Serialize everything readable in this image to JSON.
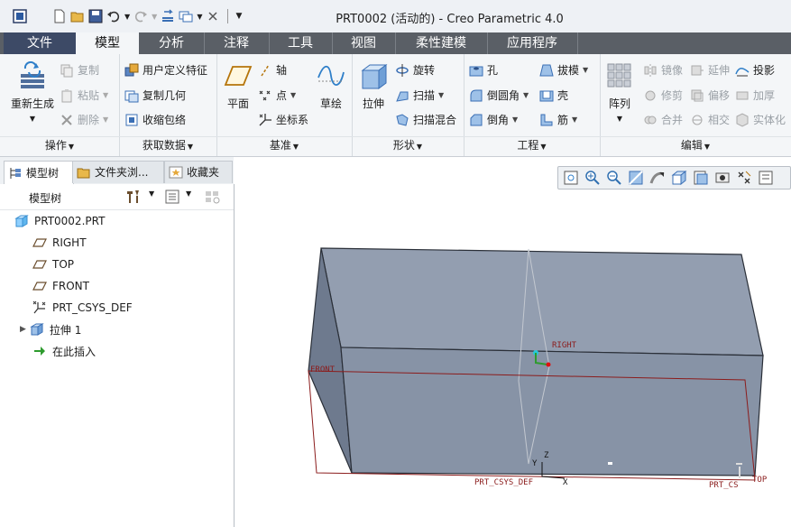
{
  "window": {
    "title": "PRT0002 (活动的) - Creo Parametric 4.0"
  },
  "quick_access": {
    "icons": [
      "app-icon",
      "new-icon",
      "open-icon",
      "save-icon",
      "undo-icon",
      "redo-icon",
      "regenerate-icon",
      "windows-icon",
      "close-window-icon",
      "customize-icon"
    ]
  },
  "tabs": [
    {
      "label": "文件"
    },
    {
      "label": "模型"
    },
    {
      "label": "分析"
    },
    {
      "label": "注释"
    },
    {
      "label": "工具"
    },
    {
      "label": "视图"
    },
    {
      "label": "柔性建模"
    },
    {
      "label": "应用程序"
    }
  ],
  "ribbon": {
    "operations": {
      "label": "操作",
      "regenerate": "重新生成",
      "copy": "复制",
      "paste": "粘贴",
      "delete": "删除"
    },
    "get_data": {
      "label": "获取数据",
      "udf": "用户定义特征",
      "copy_geom": "复制几何",
      "shrinkwrap": "收缩包络"
    },
    "datum": {
      "label": "基准",
      "plane": "平面",
      "axis": "轴",
      "point": "点",
      "csys": "坐标系",
      "sketch": "草绘"
    },
    "shapes": {
      "label": "形状",
      "extrude": "拉伸",
      "revolve": "旋转",
      "sweep": "扫描",
      "swept_blend": "扫描混合"
    },
    "engineering": {
      "label": "工程",
      "hole": "孔",
      "round": "倒圆角",
      "chamfer": "倒角",
      "draft": "拔模",
      "shell": "壳",
      "rib": "筋"
    },
    "editing": {
      "label": "编辑",
      "pattern": "阵列",
      "mirror": "镜像",
      "trim": "修剪",
      "merge": "合并",
      "extend": "延伸",
      "offset": "偏移",
      "intersect": "相交",
      "project": "投影",
      "thicken": "加厚",
      "solidify": "实体化"
    }
  },
  "left_tabs": [
    {
      "label": "模型树"
    },
    {
      "label": "文件夹浏..."
    },
    {
      "label": "收藏夹"
    }
  ],
  "model_tree": {
    "title": "模型树",
    "items": [
      {
        "label": "PRT0002.PRT"
      },
      {
        "label": "RIGHT"
      },
      {
        "label": "TOP"
      },
      {
        "label": "FRONT"
      },
      {
        "label": "PRT_CSYS_DEF"
      },
      {
        "label": "拉伸 1"
      },
      {
        "label": "在此插入"
      }
    ]
  },
  "viewport": {
    "labels": {
      "right": "RIGHT",
      "front": "FRONT",
      "top": "TOP",
      "csys": "PRT_CSYS_DEF",
      "csys2": "PRT_CS",
      "x": "X",
      "y": "Y",
      "z": "Z"
    },
    "colors": {
      "solid_top": "#939eb0",
      "solid_front": "#8793a6",
      "solid_side": "#6e7a8e",
      "datum": "#8b1c1c"
    }
  }
}
